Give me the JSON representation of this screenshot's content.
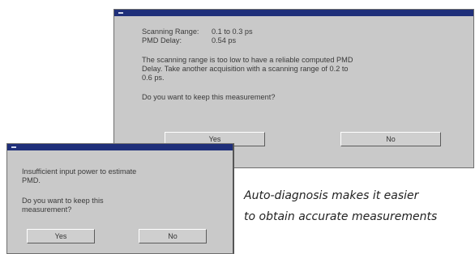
{
  "back_dialog": {
    "label_scanning_range": "Scanning Range:",
    "value_scanning_range": "0.1 to 0.3 ps",
    "label_pmd_delay": "PMD Delay:",
    "value_pmd_delay": "0.54 ps",
    "message_line1": "The scanning range is too low to have a reliable computed PMD",
    "message_line2": "Delay. Take another acquisition with a scanning range of  0.2 to",
    "message_line3": "0.6 ps.",
    "question": "Do you want to keep this measurement?",
    "yes_label": "Yes",
    "no_label": "No"
  },
  "front_dialog": {
    "message_line1": "Insufficient input power to estimate",
    "message_line2": "PMD.",
    "question_line1": "Do you want to keep this",
    "question_line2": "measurement?",
    "yes_label": "Yes",
    "no_label": "No"
  },
  "caption": {
    "line1": "Auto-diagnosis makes it easier",
    "line2": "to obtain accurate measurements"
  },
  "colors": {
    "titlebar": "#1f2f7a",
    "dialog_bg": "#c9c9c9"
  }
}
